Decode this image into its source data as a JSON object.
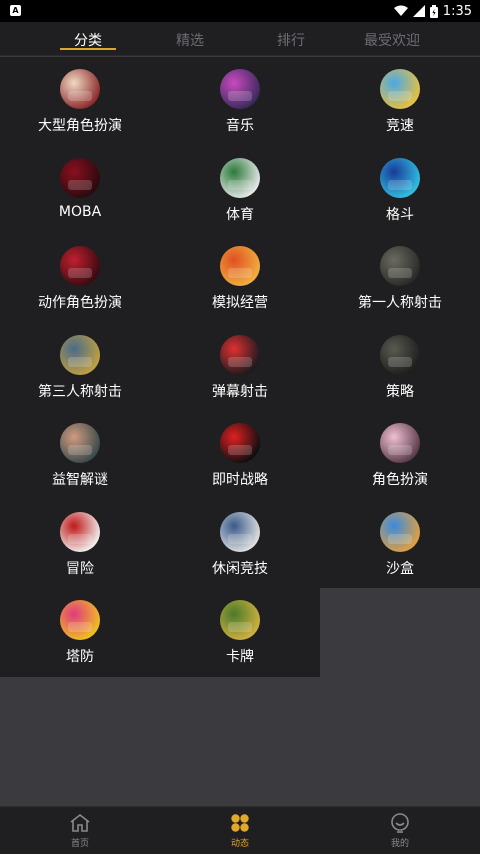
{
  "status_bar": {
    "time": "1:35"
  },
  "tabs": [
    {
      "label": "分类",
      "active": true
    },
    {
      "label": "精选",
      "active": false
    },
    {
      "label": "排行",
      "active": false
    },
    {
      "label": "最受欢迎",
      "active": false
    }
  ],
  "categories": [
    {
      "label": "大型角色扮演",
      "icon": "rpg-game-icon",
      "colors": [
        "#f0d9c4",
        "#8b2a2a"
      ]
    },
    {
      "label": "音乐",
      "icon": "music-game-icon",
      "colors": [
        "#c94ac0",
        "#3a2a5c"
      ]
    },
    {
      "label": "竞速",
      "icon": "racing-game-icon",
      "colors": [
        "#4aa8e8",
        "#e8c040"
      ]
    },
    {
      "label": "MOBA",
      "icon": "moba-game-icon",
      "colors": [
        "#8a1020",
        "#2a0a0e"
      ]
    },
    {
      "label": "体育",
      "icon": "sports-game-icon",
      "colors": [
        "#2a7a3a",
        "#e8e8e8"
      ]
    },
    {
      "label": "格斗",
      "icon": "fighting-game-icon",
      "colors": [
        "#1a3a9a",
        "#30c0e0"
      ]
    },
    {
      "label": "动作角色扮演",
      "icon": "action-rpg-game-icon",
      "colors": [
        "#c02030",
        "#3a0a10"
      ]
    },
    {
      "label": "模拟经营",
      "icon": "simulation-game-icon",
      "colors": [
        "#e05020",
        "#f0b040"
      ]
    },
    {
      "label": "第一人称射击",
      "icon": "fps-game-icon",
      "colors": [
        "#6a6a60",
        "#2a2a28"
      ]
    },
    {
      "label": "第三人称射击",
      "icon": "tps-game-icon",
      "colors": [
        "#4a6a8a",
        "#c0a040"
      ]
    },
    {
      "label": "弹幕射击",
      "icon": "bullet-hell-game-icon",
      "colors": [
        "#e03030",
        "#1a1a1e"
      ]
    },
    {
      "label": "策略",
      "icon": "strategy-game-icon",
      "colors": [
        "#5a5a52",
        "#1e1e1c"
      ]
    },
    {
      "label": "益智解谜",
      "icon": "puzzle-game-icon",
      "colors": [
        "#d09a80",
        "#3a4a4a"
      ]
    },
    {
      "label": "即时战略",
      "icon": "rts-game-icon",
      "colors": [
        "#e02020",
        "#0e0e10"
      ]
    },
    {
      "label": "角色扮演",
      "icon": "role-play-game-icon",
      "colors": [
        "#f0c0d0",
        "#5a3a4a"
      ]
    },
    {
      "label": "冒险",
      "icon": "adventure-game-icon",
      "colors": [
        "#c01818",
        "#f0f0f0"
      ]
    },
    {
      "label": "休闲竞技",
      "icon": "casual-game-icon",
      "colors": [
        "#3a5a8a",
        "#e0e0e0"
      ]
    },
    {
      "label": "沙盒",
      "icon": "sandbox-game-icon",
      "colors": [
        "#3a8ae0",
        "#e0a040"
      ]
    },
    {
      "label": "塔防",
      "icon": "tower-defense-game-icon",
      "colors": [
        "#e03a80",
        "#f0c020"
      ]
    },
    {
      "label": "卡牌",
      "icon": "card-game-icon",
      "colors": [
        "#4a7a2a",
        "#d0b040"
      ]
    }
  ],
  "bottom_nav": [
    {
      "label": "首页",
      "icon": "home-icon",
      "active": false
    },
    {
      "label": "动态",
      "icon": "feed-icon",
      "active": true
    },
    {
      "label": "我的",
      "icon": "profile-icon",
      "active": false
    }
  ],
  "colors": {
    "accent": "#e0a92a",
    "background": "#1f1f21",
    "text": "#ffffff",
    "inactive": "#6d6d72"
  }
}
